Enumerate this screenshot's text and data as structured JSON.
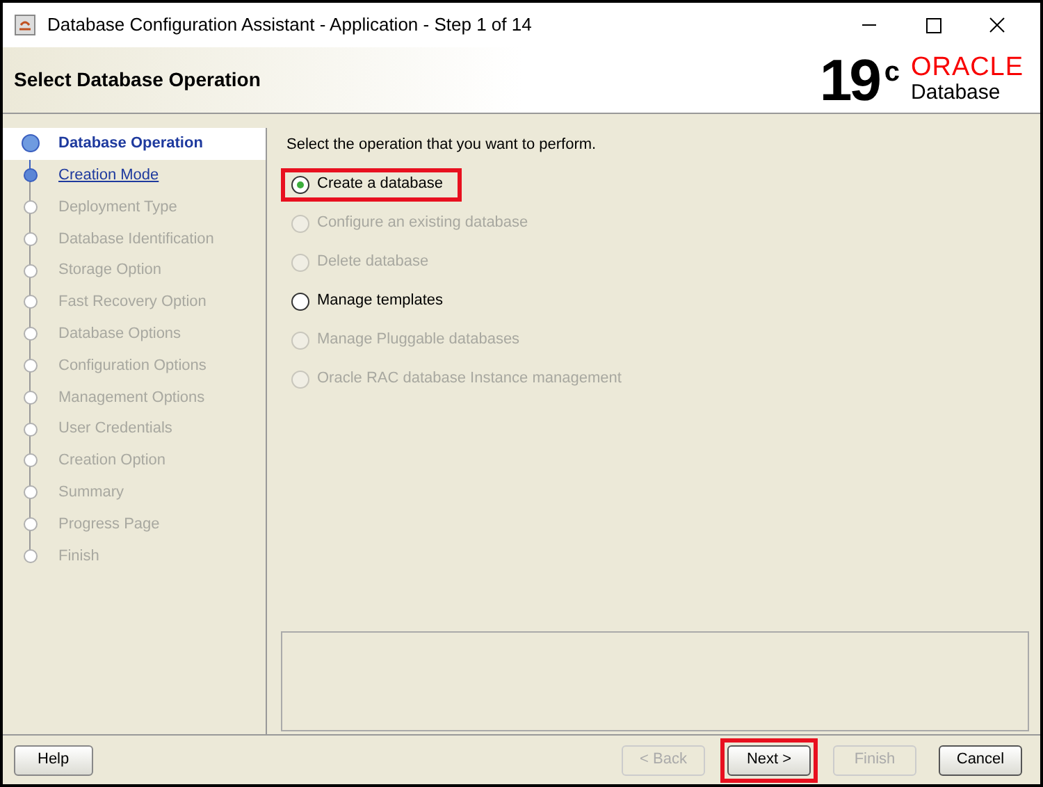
{
  "window": {
    "title": "Database Configuration Assistant - Application - Step 1 of 14"
  },
  "header": {
    "title": "Select Database Operation",
    "logo_version": "19",
    "logo_superscript": "c",
    "logo_brand": "ORACLE",
    "logo_product": "Database"
  },
  "steps": [
    {
      "label": "Database Operation",
      "selected": true,
      "disabled": false
    },
    {
      "label": "Creation Mode",
      "selected": false,
      "disabled": false
    },
    {
      "label": "Deployment Type",
      "selected": false,
      "disabled": true
    },
    {
      "label": "Database Identification",
      "selected": false,
      "disabled": true
    },
    {
      "label": "Storage Option",
      "selected": false,
      "disabled": true
    },
    {
      "label": "Fast Recovery Option",
      "selected": false,
      "disabled": true
    },
    {
      "label": "Database Options",
      "selected": false,
      "disabled": true
    },
    {
      "label": "Configuration Options",
      "selected": false,
      "disabled": true
    },
    {
      "label": "Management Options",
      "selected": false,
      "disabled": true
    },
    {
      "label": "User Credentials",
      "selected": false,
      "disabled": true
    },
    {
      "label": "Creation Option",
      "selected": false,
      "disabled": true
    },
    {
      "label": "Summary",
      "selected": false,
      "disabled": true
    },
    {
      "label": "Progress Page",
      "selected": false,
      "disabled": true
    },
    {
      "label": "Finish",
      "selected": false,
      "disabled": true
    }
  ],
  "prompt": "Select the operation that you want to perform.",
  "options": [
    {
      "label": "Create a database",
      "selected": true,
      "disabled": false,
      "highlighted": true
    },
    {
      "label": "Configure an existing database",
      "selected": false,
      "disabled": true,
      "highlighted": false
    },
    {
      "label": "Delete database",
      "selected": false,
      "disabled": true,
      "highlighted": false
    },
    {
      "label": "Manage templates",
      "selected": false,
      "disabled": false,
      "highlighted": false
    },
    {
      "label": "Manage Pluggable databases",
      "selected": false,
      "disabled": true,
      "highlighted": false
    },
    {
      "label": "Oracle RAC database Instance management",
      "selected": false,
      "disabled": true,
      "highlighted": false
    }
  ],
  "help_button": "Help",
  "buttons": [
    {
      "label": "< Back",
      "disabled": true,
      "highlighted": false
    },
    {
      "label": "Next >",
      "disabled": false,
      "highlighted": true
    },
    {
      "label": "Finish",
      "disabled": true,
      "highlighted": false
    },
    {
      "label": "Cancel",
      "disabled": false,
      "highlighted": false
    }
  ]
}
